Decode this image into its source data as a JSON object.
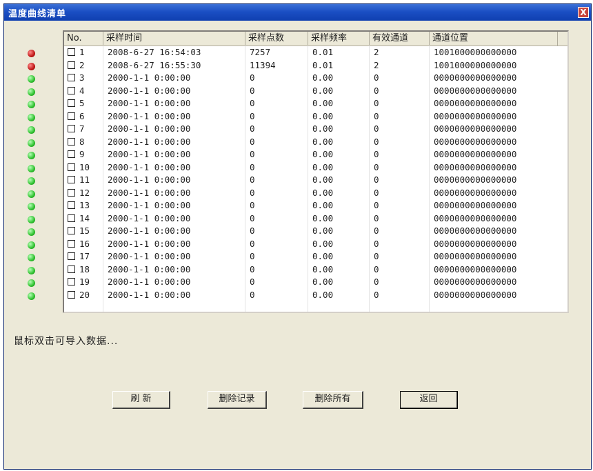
{
  "window": {
    "title": "温度曲线清单",
    "close_glyph": "X"
  },
  "table": {
    "columns": [
      "No.",
      "采样时间",
      "采样点数",
      "采样频率",
      "有效通道",
      "通道位置"
    ],
    "rows": [
      {
        "no": "1",
        "time": "2008-6-27 16:54:03",
        "points": "7257",
        "freq": "0.01",
        "channels": "2",
        "position": "1001000000000000",
        "status": "red"
      },
      {
        "no": "2",
        "time": "2008-6-27 16:55:30",
        "points": "11394",
        "freq": "0.01",
        "channels": "2",
        "position": "1001000000000000",
        "status": "red"
      },
      {
        "no": "3",
        "time": "2000-1-1  0:00:00",
        "points": "0",
        "freq": "0.00",
        "channels": "0",
        "position": "0000000000000000",
        "status": "green"
      },
      {
        "no": "4",
        "time": "2000-1-1  0:00:00",
        "points": "0",
        "freq": "0.00",
        "channels": "0",
        "position": "0000000000000000",
        "status": "green"
      },
      {
        "no": "5",
        "time": "2000-1-1  0:00:00",
        "points": "0",
        "freq": "0.00",
        "channels": "0",
        "position": "0000000000000000",
        "status": "green"
      },
      {
        "no": "6",
        "time": "2000-1-1  0:00:00",
        "points": "0",
        "freq": "0.00",
        "channels": "0",
        "position": "0000000000000000",
        "status": "green"
      },
      {
        "no": "7",
        "time": "2000-1-1  0:00:00",
        "points": "0",
        "freq": "0.00",
        "channels": "0",
        "position": "0000000000000000",
        "status": "green"
      },
      {
        "no": "8",
        "time": "2000-1-1  0:00:00",
        "points": "0",
        "freq": "0.00",
        "channels": "0",
        "position": "0000000000000000",
        "status": "green"
      },
      {
        "no": "9",
        "time": "2000-1-1  0:00:00",
        "points": "0",
        "freq": "0.00",
        "channels": "0",
        "position": "0000000000000000",
        "status": "green"
      },
      {
        "no": "10",
        "time": "2000-1-1  0:00:00",
        "points": "0",
        "freq": "0.00",
        "channels": "0",
        "position": "0000000000000000",
        "status": "green"
      },
      {
        "no": "11",
        "time": "2000-1-1  0:00:00",
        "points": "0",
        "freq": "0.00",
        "channels": "0",
        "position": "0000000000000000",
        "status": "green"
      },
      {
        "no": "12",
        "time": "2000-1-1  0:00:00",
        "points": "0",
        "freq": "0.00",
        "channels": "0",
        "position": "0000000000000000",
        "status": "green"
      },
      {
        "no": "13",
        "time": "2000-1-1  0:00:00",
        "points": "0",
        "freq": "0.00",
        "channels": "0",
        "position": "0000000000000000",
        "status": "green"
      },
      {
        "no": "14",
        "time": "2000-1-1  0:00:00",
        "points": "0",
        "freq": "0.00",
        "channels": "0",
        "position": "0000000000000000",
        "status": "green"
      },
      {
        "no": "15",
        "time": "2000-1-1  0:00:00",
        "points": "0",
        "freq": "0.00",
        "channels": "0",
        "position": "0000000000000000",
        "status": "green"
      },
      {
        "no": "16",
        "time": "2000-1-1  0:00:00",
        "points": "0",
        "freq": "0.00",
        "channels": "0",
        "position": "0000000000000000",
        "status": "green"
      },
      {
        "no": "17",
        "time": "2000-1-1  0:00:00",
        "points": "0",
        "freq": "0.00",
        "channels": "0",
        "position": "0000000000000000",
        "status": "green"
      },
      {
        "no": "18",
        "time": "2000-1-1  0:00:00",
        "points": "0",
        "freq": "0.00",
        "channels": "0",
        "position": "0000000000000000",
        "status": "green"
      },
      {
        "no": "19",
        "time": "2000-1-1  0:00:00",
        "points": "0",
        "freq": "0.00",
        "channels": "0",
        "position": "0000000000000000",
        "status": "green"
      },
      {
        "no": "20",
        "time": "2000-1-1  0:00:00",
        "points": "0",
        "freq": "0.00",
        "channels": "0",
        "position": "0000000000000000",
        "status": "green"
      }
    ]
  },
  "hint": "鼠标双击可导入数据...",
  "buttons": {
    "refresh": "刷 新",
    "delete_record": "删除记录",
    "delete_all": "删除所有",
    "back": "返回"
  },
  "colors": {
    "title_bar": "#1b4fc4",
    "window_bg": "#ece9d8",
    "status_red": "#c01818",
    "status_green": "#2fc22f"
  }
}
